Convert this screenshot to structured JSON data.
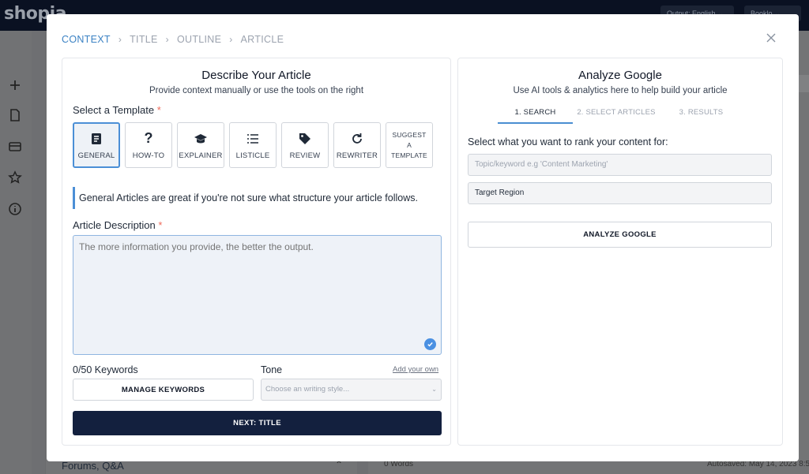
{
  "app": {
    "logo": "shopia",
    "top_pills": [
      "Output: English ⌄",
      "Booklo ⌄"
    ],
    "rail_icons": [
      "plus-icon",
      "document-icon",
      "card-icon",
      "star-icon",
      "info-icon"
    ],
    "bg_forums": "Forums, Q&A",
    "bg_forums_chevron": "⌃",
    "bg_words": "0 Words",
    "bg_autosave": "Autosaved: May 14, 2023 8:5",
    "bg_edge_button": "t"
  },
  "stepper": {
    "steps": [
      {
        "label": "CONTEXT",
        "active": true
      },
      {
        "label": "TITLE",
        "active": false
      },
      {
        "label": "OUTLINE",
        "active": false
      },
      {
        "label": "ARTICLE",
        "active": false
      }
    ],
    "separator": "›"
  },
  "left": {
    "title": "Describe Your Article",
    "subtitle": "Provide context manually or use the tools on the right",
    "template_label": "Select a Template",
    "required_mark": "*",
    "templates": [
      {
        "label": "GENERAL",
        "icon": "document-icon",
        "selected": true
      },
      {
        "label": "HOW-TO",
        "icon": "question-icon",
        "selected": false
      },
      {
        "label": "EXPLAINER",
        "icon": "graduation-cap-icon",
        "selected": false
      },
      {
        "label": "LISTICLE",
        "icon": "list-icon",
        "selected": false
      },
      {
        "label": "REVIEW",
        "icon": "tag-icon",
        "selected": false
      },
      {
        "label": "REWRITER",
        "icon": "refresh-icon",
        "selected": false
      }
    ],
    "suggest_template": {
      "line1": "SUGGEST",
      "line2": "A",
      "line3": "TEMPLATE"
    },
    "info_note": "General Articles are great if you're not sure what structure your article follows.",
    "description_label": "Article Description",
    "description_placeholder": "The more information you provide, the better the output.",
    "keywords_label": "0/50 Keywords",
    "tone_label": "Tone",
    "add_own_link": "Add your own",
    "manage_keywords_button": "MANAGE KEYWORDS",
    "tone_placeholder": "Choose an writing style...",
    "next_button": "NEXT: TITLE"
  },
  "right": {
    "title": "Analyze Google",
    "subtitle": "Use AI tools & analytics here to help build your article",
    "tabs": [
      {
        "label": "1. SEARCH",
        "active": true
      },
      {
        "label": "2. SELECT ARTICLES",
        "active": false
      },
      {
        "label": "3. RESULTS",
        "active": false
      }
    ],
    "question": "Select what you want to rank your content for:",
    "keyword_placeholder": "Topic/keyword e.g 'Content Marketing'",
    "region_value": "Target Region",
    "analyze_button": "ANALYZE GOOGLE"
  },
  "colors": {
    "accent": "#4b8fd6",
    "primary_button": "#13203e",
    "required": "#ef6b5b"
  }
}
